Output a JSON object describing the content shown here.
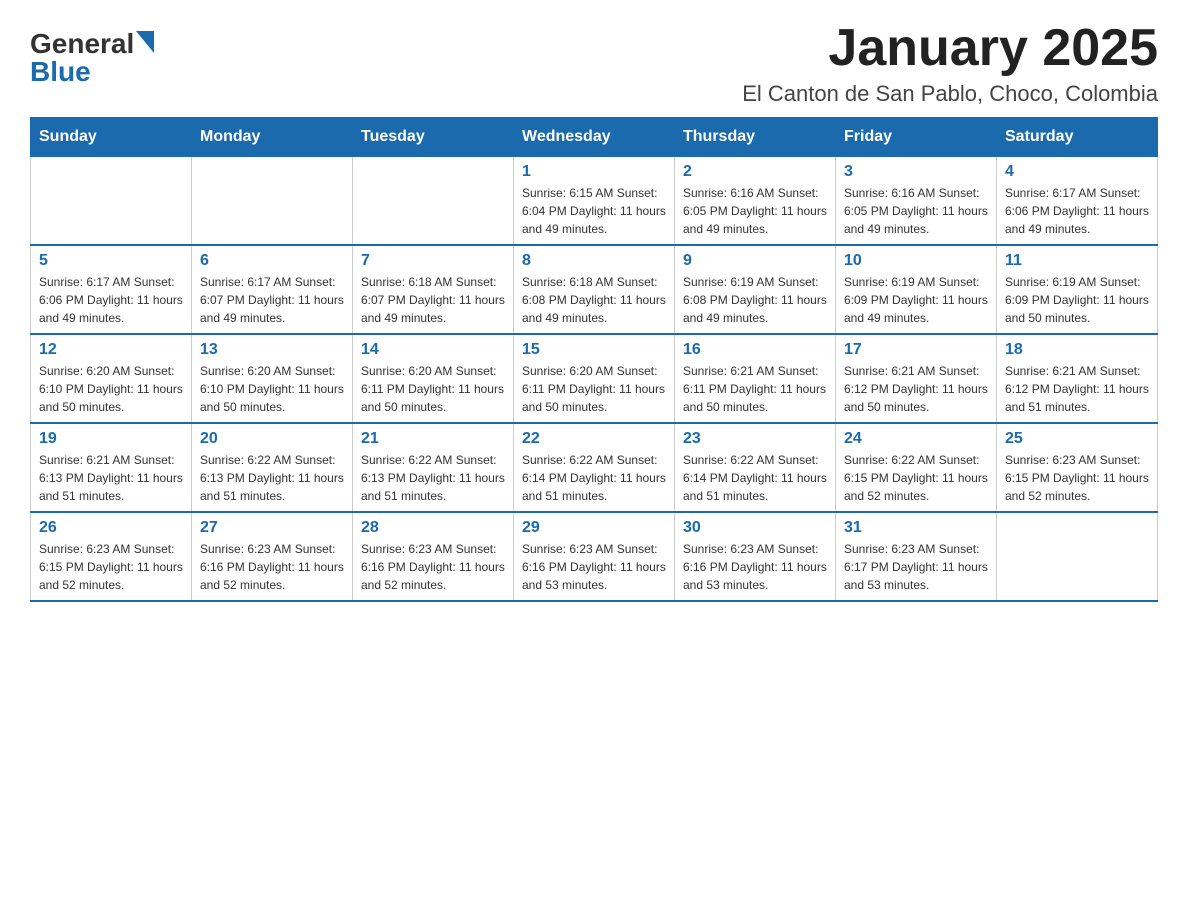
{
  "header": {
    "logo_general": "General",
    "logo_blue": "Blue",
    "title": "January 2025",
    "subtitle": "El Canton de San Pablo, Choco, Colombia"
  },
  "days_of_week": [
    "Sunday",
    "Monday",
    "Tuesday",
    "Wednesday",
    "Thursday",
    "Friday",
    "Saturday"
  ],
  "weeks": [
    [
      {
        "day": "",
        "info": ""
      },
      {
        "day": "",
        "info": ""
      },
      {
        "day": "",
        "info": ""
      },
      {
        "day": "1",
        "info": "Sunrise: 6:15 AM\nSunset: 6:04 PM\nDaylight: 11 hours and 49 minutes."
      },
      {
        "day": "2",
        "info": "Sunrise: 6:16 AM\nSunset: 6:05 PM\nDaylight: 11 hours and 49 minutes."
      },
      {
        "day": "3",
        "info": "Sunrise: 6:16 AM\nSunset: 6:05 PM\nDaylight: 11 hours and 49 minutes."
      },
      {
        "day": "4",
        "info": "Sunrise: 6:17 AM\nSunset: 6:06 PM\nDaylight: 11 hours and 49 minutes."
      }
    ],
    [
      {
        "day": "5",
        "info": "Sunrise: 6:17 AM\nSunset: 6:06 PM\nDaylight: 11 hours and 49 minutes."
      },
      {
        "day": "6",
        "info": "Sunrise: 6:17 AM\nSunset: 6:07 PM\nDaylight: 11 hours and 49 minutes."
      },
      {
        "day": "7",
        "info": "Sunrise: 6:18 AM\nSunset: 6:07 PM\nDaylight: 11 hours and 49 minutes."
      },
      {
        "day": "8",
        "info": "Sunrise: 6:18 AM\nSunset: 6:08 PM\nDaylight: 11 hours and 49 minutes."
      },
      {
        "day": "9",
        "info": "Sunrise: 6:19 AM\nSunset: 6:08 PM\nDaylight: 11 hours and 49 minutes."
      },
      {
        "day": "10",
        "info": "Sunrise: 6:19 AM\nSunset: 6:09 PM\nDaylight: 11 hours and 49 minutes."
      },
      {
        "day": "11",
        "info": "Sunrise: 6:19 AM\nSunset: 6:09 PM\nDaylight: 11 hours and 50 minutes."
      }
    ],
    [
      {
        "day": "12",
        "info": "Sunrise: 6:20 AM\nSunset: 6:10 PM\nDaylight: 11 hours and 50 minutes."
      },
      {
        "day": "13",
        "info": "Sunrise: 6:20 AM\nSunset: 6:10 PM\nDaylight: 11 hours and 50 minutes."
      },
      {
        "day": "14",
        "info": "Sunrise: 6:20 AM\nSunset: 6:11 PM\nDaylight: 11 hours and 50 minutes."
      },
      {
        "day": "15",
        "info": "Sunrise: 6:20 AM\nSunset: 6:11 PM\nDaylight: 11 hours and 50 minutes."
      },
      {
        "day": "16",
        "info": "Sunrise: 6:21 AM\nSunset: 6:11 PM\nDaylight: 11 hours and 50 minutes."
      },
      {
        "day": "17",
        "info": "Sunrise: 6:21 AM\nSunset: 6:12 PM\nDaylight: 11 hours and 50 minutes."
      },
      {
        "day": "18",
        "info": "Sunrise: 6:21 AM\nSunset: 6:12 PM\nDaylight: 11 hours and 51 minutes."
      }
    ],
    [
      {
        "day": "19",
        "info": "Sunrise: 6:21 AM\nSunset: 6:13 PM\nDaylight: 11 hours and 51 minutes."
      },
      {
        "day": "20",
        "info": "Sunrise: 6:22 AM\nSunset: 6:13 PM\nDaylight: 11 hours and 51 minutes."
      },
      {
        "day": "21",
        "info": "Sunrise: 6:22 AM\nSunset: 6:13 PM\nDaylight: 11 hours and 51 minutes."
      },
      {
        "day": "22",
        "info": "Sunrise: 6:22 AM\nSunset: 6:14 PM\nDaylight: 11 hours and 51 minutes."
      },
      {
        "day": "23",
        "info": "Sunrise: 6:22 AM\nSunset: 6:14 PM\nDaylight: 11 hours and 51 minutes."
      },
      {
        "day": "24",
        "info": "Sunrise: 6:22 AM\nSunset: 6:15 PM\nDaylight: 11 hours and 52 minutes."
      },
      {
        "day": "25",
        "info": "Sunrise: 6:23 AM\nSunset: 6:15 PM\nDaylight: 11 hours and 52 minutes."
      }
    ],
    [
      {
        "day": "26",
        "info": "Sunrise: 6:23 AM\nSunset: 6:15 PM\nDaylight: 11 hours and 52 minutes."
      },
      {
        "day": "27",
        "info": "Sunrise: 6:23 AM\nSunset: 6:16 PM\nDaylight: 11 hours and 52 minutes."
      },
      {
        "day": "28",
        "info": "Sunrise: 6:23 AM\nSunset: 6:16 PM\nDaylight: 11 hours and 52 minutes."
      },
      {
        "day": "29",
        "info": "Sunrise: 6:23 AM\nSunset: 6:16 PM\nDaylight: 11 hours and 53 minutes."
      },
      {
        "day": "30",
        "info": "Sunrise: 6:23 AM\nSunset: 6:16 PM\nDaylight: 11 hours and 53 minutes."
      },
      {
        "day": "31",
        "info": "Sunrise: 6:23 AM\nSunset: 6:17 PM\nDaylight: 11 hours and 53 minutes."
      },
      {
        "day": "",
        "info": ""
      }
    ]
  ]
}
